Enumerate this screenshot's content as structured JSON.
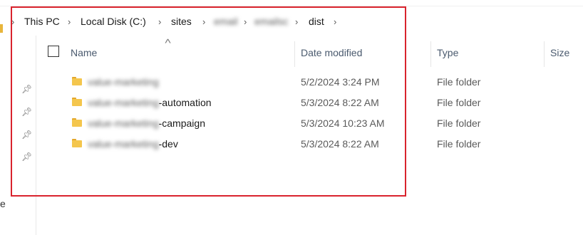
{
  "breadcrumb": {
    "items": [
      "This PC",
      "Local Disk (C:)",
      "sites",
      "email",
      "emailsc",
      "dist"
    ]
  },
  "columns": {
    "name": "Name",
    "date_modified": "Date modified",
    "type": "Type",
    "size": "Size"
  },
  "rows": [
    {
      "name_blurred": "value-marketing",
      "name_suffix": "",
      "date": "5/2/2024 3:24 PM",
      "type": "File folder"
    },
    {
      "name_blurred": "value-marketing",
      "name_suffix": "-automation",
      "date": "5/3/2024 8:22 AM",
      "type": "File folder"
    },
    {
      "name_blurred": "value-marketing",
      "name_suffix": "-campaign",
      "date": "5/3/2024 10:23 AM",
      "type": "File folder"
    },
    {
      "name_blurred": "value-marketing",
      "name_suffix": "-dev",
      "date": "5/3/2024 8:22 AM",
      "type": "File folder"
    }
  ],
  "nav": {
    "partial_label": "e"
  },
  "icons": {
    "pin": "pin-icon",
    "folder": "folder-icon",
    "sort": "sort-up-icon",
    "chevron": "chevron-right-icon"
  },
  "colors": {
    "annotation": "#d9232d",
    "folder": "#f4c64d",
    "header_text": "#4a5a6e"
  }
}
